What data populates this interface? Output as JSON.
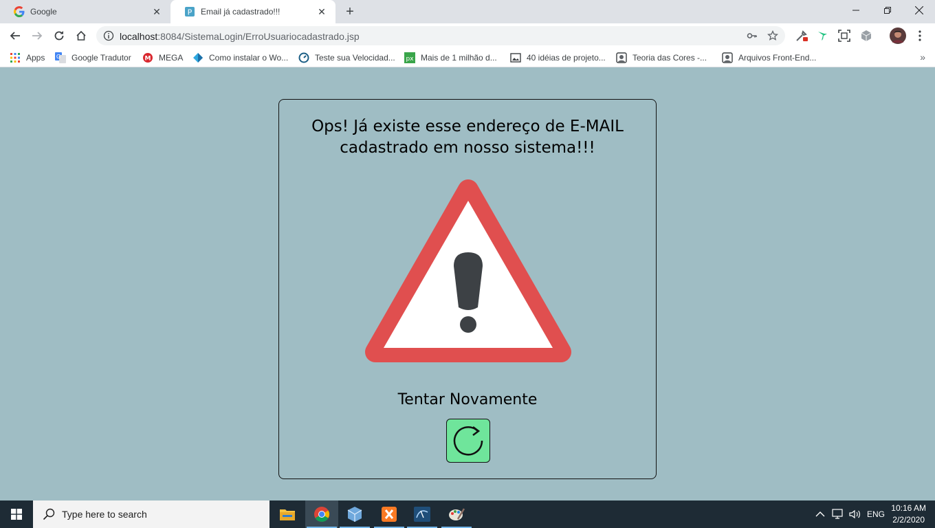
{
  "browser": {
    "tabs": [
      {
        "title": "Google",
        "icon": "google-icon"
      },
      {
        "title": "Email já cadastrado!!!",
        "icon": "p-favicon-icon",
        "active": true
      }
    ],
    "url_host": "localhost",
    "url_path": ":8084/SistemaLogin/ErroUsuariocadastrado.jsp",
    "bookmarks": [
      {
        "label": "Apps",
        "icon": "apps-grid-icon"
      },
      {
        "label": "Google Tradutor",
        "icon": "translate-icon"
      },
      {
        "label": "MEGA",
        "icon": "mega-icon"
      },
      {
        "label": "Como instalar o Wo...",
        "icon": "diamond-icon"
      },
      {
        "label": "Teste sua Velocidad...",
        "icon": "speedtest-icon"
      },
      {
        "label": "Mais de 1 milhão d...",
        "icon": "px-icon"
      },
      {
        "label": "40 idéias de projeto...",
        "icon": "image-icon"
      },
      {
        "label": "Teoria das Cores -...",
        "icon": "profile-icon"
      },
      {
        "label": "Arquivos Front-End...",
        "icon": "profile-icon"
      }
    ]
  },
  "page": {
    "heading_line1": "Ops! Já existe esse endereço de E-MAIL",
    "heading_line2": "cadastrado em nosso sistema!!!",
    "retry_label": "Tentar Novamente",
    "colors": {
      "background": "#9fbdc4",
      "warning_red": "#e04f4f",
      "warning_mark": "#3d4145",
      "retry_green": "#6fe59b"
    }
  },
  "taskbar": {
    "search_placeholder": "Type here to search",
    "language": "ENG",
    "time": "10:16 AM",
    "date": "2/2/2020"
  }
}
